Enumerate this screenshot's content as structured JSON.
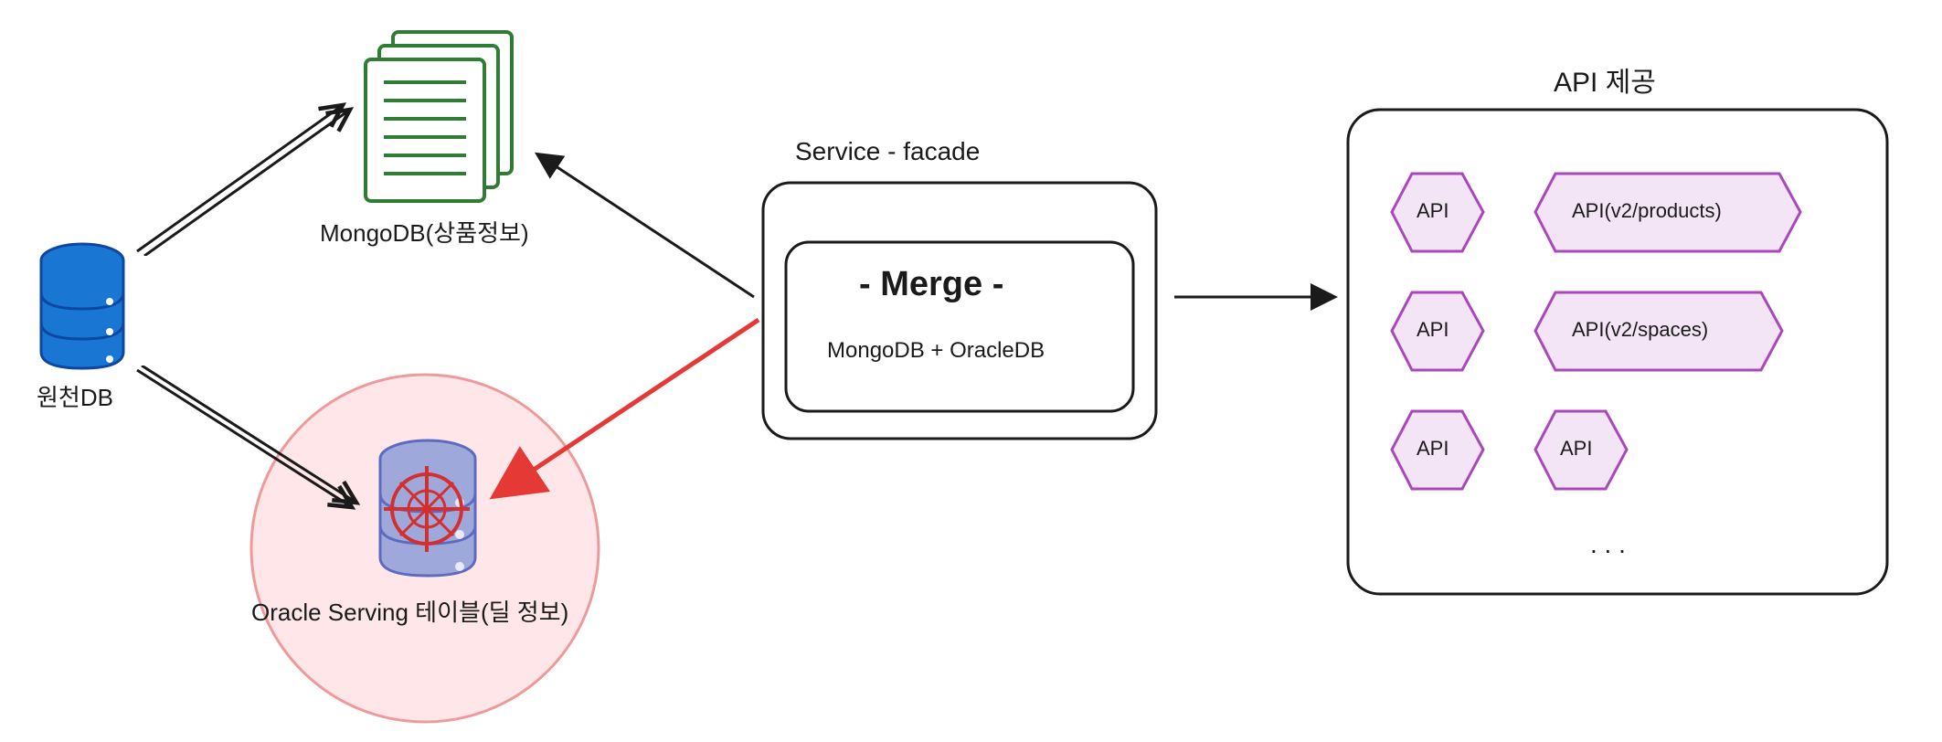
{
  "sourceDB": {
    "label": "원천DB"
  },
  "mongoDB": {
    "label": "MongoDB(상품정보)"
  },
  "oracleServing": {
    "label": "Oracle Serving 테이블(딜 정보)"
  },
  "serviceFacade": {
    "title": "Service - facade",
    "merge": {
      "title": "- Merge -",
      "subtitle": "MongoDB + OracleDB"
    }
  },
  "apiProvision": {
    "title": "API 제공",
    "hexagons": [
      {
        "label": "API"
      },
      {
        "label": "API(v2/products)"
      },
      {
        "label": "API"
      },
      {
        "label": "API(v2/spaces)"
      },
      {
        "label": "API"
      },
      {
        "label": "API"
      }
    ],
    "ellipsis": ". . ."
  }
}
